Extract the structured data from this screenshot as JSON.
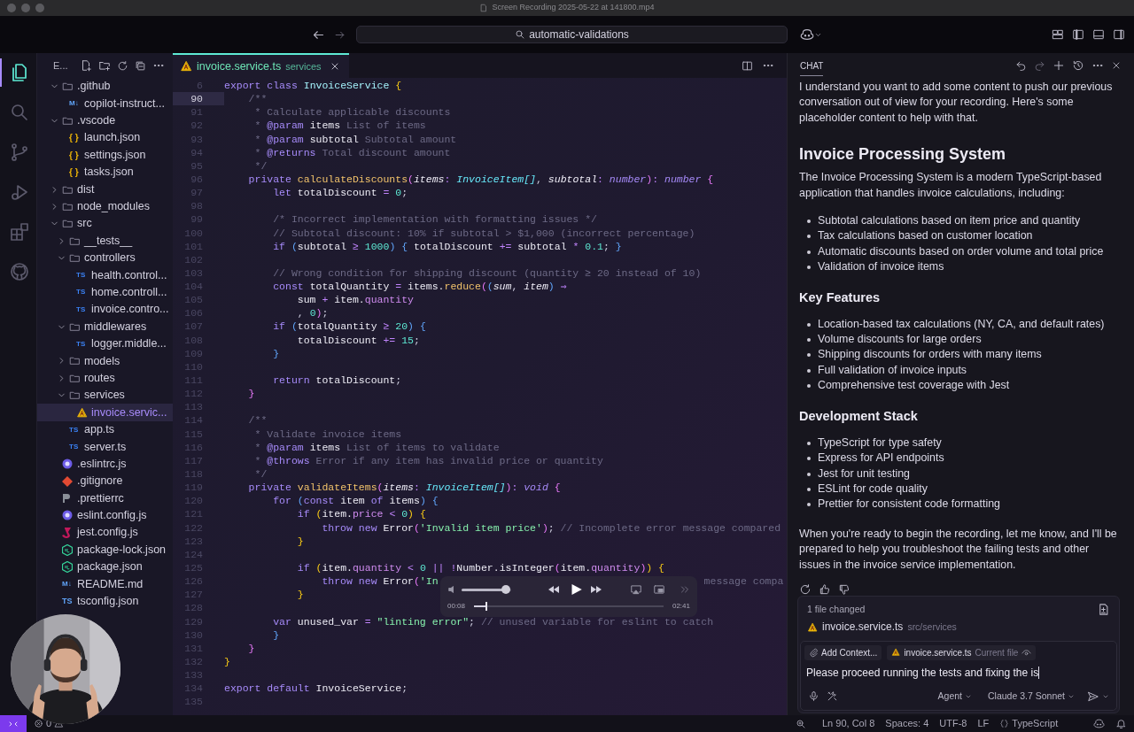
{
  "window": {
    "title": "Screen Recording 2025-05-22 at 141800.mp4"
  },
  "titlebar": {
    "search": "automatic-validations"
  },
  "activity_bar": [
    {
      "kind": "files",
      "selected": true
    },
    {
      "kind": "search",
      "selected": false
    },
    {
      "kind": "source-control",
      "selected": false
    },
    {
      "kind": "run",
      "selected": false
    },
    {
      "kind": "extensions",
      "selected": false
    },
    {
      "kind": "github",
      "selected": false
    }
  ],
  "explorer": {
    "title": "E...",
    "tree": [
      {
        "name": ".github",
        "kind": "folder",
        "expanded": true,
        "selected": false,
        "children": [
          {
            "name": "copilot-instruct...",
            "kind": "markdown",
            "badge": "M↓",
            "selected": false
          }
        ]
      },
      {
        "name": ".vscode",
        "kind": "folder",
        "expanded": true,
        "selected": false,
        "children": [
          {
            "name": "launch.json",
            "kind": "json",
            "badge": "{ }",
            "selected": false
          },
          {
            "name": "settings.json",
            "kind": "json",
            "badge": "{ }",
            "selected": false
          },
          {
            "name": "tasks.json",
            "kind": "json",
            "badge": "{ }",
            "selected": false
          }
        ]
      },
      {
        "name": "dist",
        "kind": "folder",
        "expanded": false,
        "selected": false
      },
      {
        "name": "node_modules",
        "kind": "folder",
        "expanded": false,
        "selected": false
      },
      {
        "name": "src",
        "kind": "folder",
        "expanded": true,
        "selected": false,
        "children": [
          {
            "name": "__tests__",
            "kind": "folder",
            "expanded": false,
            "selected": false
          },
          {
            "name": "controllers",
            "kind": "folder",
            "expanded": true,
            "selected": false,
            "children": [
              {
                "name": "health.control...",
                "kind": "ts",
                "badge": "TS",
                "selected": false
              },
              {
                "name": "home.controll...",
                "kind": "ts",
                "badge": "TS",
                "selected": false
              },
              {
                "name": "invoice.contro...",
                "kind": "ts",
                "badge": "TS",
                "selected": false
              }
            ]
          },
          {
            "name": "middlewares",
            "kind": "folder",
            "expanded": true,
            "selected": false,
            "children": [
              {
                "name": "logger.middle...",
                "kind": "ts",
                "badge": "TS",
                "selected": false
              }
            ]
          },
          {
            "name": "models",
            "kind": "folder",
            "expanded": false,
            "selected": false
          },
          {
            "name": "routes",
            "kind": "folder",
            "expanded": false,
            "selected": false
          },
          {
            "name": "services",
            "kind": "folder",
            "expanded": true,
            "selected": false,
            "children": [
              {
                "name": "invoice.servic...",
                "kind": "service",
                "selected": true
              }
            ]
          },
          {
            "name": "app.ts",
            "kind": "ts",
            "badge": "TS",
            "selected": false
          },
          {
            "name": "server.ts",
            "kind": "ts",
            "badge": "TS",
            "selected": false
          }
        ]
      },
      {
        "name": ".eslintrc.js",
        "kind": "eslint",
        "selected": false
      },
      {
        "name": ".gitignore",
        "kind": "git",
        "selected": false
      },
      {
        "name": ".prettierrc",
        "kind": "prettier",
        "selected": false
      },
      {
        "name": "eslint.config.js",
        "kind": "eslint",
        "selected": false
      },
      {
        "name": "jest.config.js",
        "kind": "jest",
        "selected": false
      },
      {
        "name": "package-lock.json",
        "kind": "node",
        "selected": false
      },
      {
        "name": "package.json",
        "kind": "node",
        "selected": false
      },
      {
        "name": "README.md",
        "kind": "markdown",
        "badge": "M↓",
        "selected": false
      },
      {
        "name": "tsconfig.json",
        "kind": "tsconfig",
        "badge": "TS",
        "selected": false
      }
    ]
  },
  "editor": {
    "tab": {
      "name": "invoice.service.ts",
      "folder": "services",
      "selected": true
    },
    "lines": [
      {
        "n": "6",
        "current": false,
        "t": [
          {
            "text": "export ",
            "kind": "k"
          },
          {
            "text": "class ",
            "kind": "k"
          },
          {
            "text": "InvoiceService ",
            "kind": "cls"
          },
          {
            "text": "{",
            "kind": "b1"
          }
        ]
      },
      {
        "n": "90",
        "current": true,
        "t": [
          {
            "text": "    /**",
            "kind": "c"
          }
        ]
      },
      {
        "n": "91",
        "current": false,
        "t": [
          {
            "text": "     * Calculate applicable discounts",
            "kind": "c"
          }
        ]
      },
      {
        "n": "92",
        "current": false,
        "t": [
          {
            "text": "     * ",
            "kind": "c"
          },
          {
            "text": "@param ",
            "kind": "d"
          },
          {
            "text": "items ",
            "kind": "id"
          },
          {
            "text": "List of items",
            "kind": "c"
          }
        ]
      },
      {
        "n": "93",
        "current": false,
        "t": [
          {
            "text": "     * ",
            "kind": "c"
          },
          {
            "text": "@param ",
            "kind": "d"
          },
          {
            "text": "subtotal ",
            "kind": "id"
          },
          {
            "text": "Subtotal amount",
            "kind": "c"
          }
        ]
      },
      {
        "n": "94",
        "current": false,
        "t": [
          {
            "text": "     * ",
            "kind": "c"
          },
          {
            "text": "@returns ",
            "kind": "d"
          },
          {
            "text": "Total discount amount",
            "kind": "c"
          }
        ]
      },
      {
        "n": "95",
        "current": false,
        "t": [
          {
            "text": "     */",
            "kind": "c"
          }
        ]
      },
      {
        "n": "96",
        "current": false,
        "t": [
          {
            "text": "    private ",
            "kind": "k"
          },
          {
            "text": "calculateDiscounts",
            "kind": "fn"
          },
          {
            "text": "(",
            "kind": "b2"
          },
          {
            "text": "items",
            "kind": "p"
          },
          {
            "text": ": ",
            "kind": "op"
          },
          {
            "text": "InvoiceItem[]",
            "kind": "t"
          },
          {
            "text": ", ",
            "kind": "pl"
          },
          {
            "text": "subtotal",
            "kind": "p"
          },
          {
            "text": ": ",
            "kind": "op"
          },
          {
            "text": "number",
            "kind": "ti"
          },
          {
            "text": ")",
            "kind": "b2"
          },
          {
            "text": ": ",
            "kind": "op"
          },
          {
            "text": "number ",
            "kind": "ti"
          },
          {
            "text": "{",
            "kind": "b2"
          }
        ]
      },
      {
        "n": "97",
        "current": false,
        "t": [
          {
            "text": "        let ",
            "kind": "k"
          },
          {
            "text": "totalDiscount ",
            "kind": "id"
          },
          {
            "text": "= ",
            "kind": "op"
          },
          {
            "text": "0",
            "kind": "n"
          },
          {
            "text": ";",
            "kind": "pl"
          }
        ]
      },
      {
        "n": "98",
        "current": false
      },
      {
        "n": "99",
        "current": false,
        "t": [
          {
            "text": "        /* Incorrect implementation with formatting issues */",
            "kind": "c"
          }
        ]
      },
      {
        "n": "100",
        "current": false,
        "t": [
          {
            "text": "        // Subtotal discount: 10% if subtotal > $1,000 (incorrect percentage)",
            "kind": "c"
          }
        ]
      },
      {
        "n": "101",
        "current": false,
        "t": [
          {
            "text": "        if ",
            "kind": "k"
          },
          {
            "text": "(",
            "kind": "b3"
          },
          {
            "text": "subtotal ",
            "kind": "id"
          },
          {
            "text": "≥ ",
            "kind": "op"
          },
          {
            "text": "1000",
            "kind": "n"
          },
          {
            "text": ") ",
            "kind": "b3"
          },
          {
            "text": "{ ",
            "kind": "b3"
          },
          {
            "text": "totalDiscount ",
            "kind": "id"
          },
          {
            "text": "+= ",
            "kind": "op"
          },
          {
            "text": "subtotal ",
            "kind": "id"
          },
          {
            "text": "* ",
            "kind": "op"
          },
          {
            "text": "0.1",
            "kind": "n"
          },
          {
            "text": "; ",
            "kind": "pl"
          },
          {
            "text": "}",
            "kind": "b3"
          }
        ]
      },
      {
        "n": "102",
        "current": false
      },
      {
        "n": "103",
        "current": false,
        "t": [
          {
            "text": "        // Wrong condition for shipping discount (quantity ≥ 20 instead of 10)",
            "kind": "c"
          }
        ]
      },
      {
        "n": "104",
        "current": false,
        "t": [
          {
            "text": "        const ",
            "kind": "k"
          },
          {
            "text": "totalQuantity ",
            "kind": "id"
          },
          {
            "text": "= ",
            "kind": "op"
          },
          {
            "text": "items.",
            "kind": "id"
          },
          {
            "text": "reduce",
            "kind": "fn"
          },
          {
            "text": "(",
            "kind": "b2"
          },
          {
            "text": "(",
            "kind": "b3"
          },
          {
            "text": "sum",
            "kind": "p"
          },
          {
            "text": ", ",
            "kind": "pl"
          },
          {
            "text": "item",
            "kind": "p"
          },
          {
            "text": ") ",
            "kind": "b3"
          },
          {
            "text": "⇒",
            "kind": "op"
          }
        ]
      },
      {
        "n": "105",
        "current": false,
        "t": [
          {
            "text": "            sum ",
            "kind": "id"
          },
          {
            "text": "+ ",
            "kind": "op"
          },
          {
            "text": "item.",
            "kind": "id"
          },
          {
            "text": "quantity",
            "kind": "prop"
          }
        ]
      },
      {
        "n": "106",
        "current": false,
        "t": [
          {
            "text": "            , ",
            "kind": "pl"
          },
          {
            "text": "0",
            "kind": "n"
          },
          {
            "text": ")",
            "kind": "b2"
          },
          {
            "text": ";",
            "kind": "pl"
          }
        ]
      },
      {
        "n": "107",
        "current": false,
        "t": [
          {
            "text": "        if ",
            "kind": "k"
          },
          {
            "text": "(",
            "kind": "b3"
          },
          {
            "text": "totalQuantity ",
            "kind": "id"
          },
          {
            "text": "≥ ",
            "kind": "op"
          },
          {
            "text": "20",
            "kind": "n"
          },
          {
            "text": ") ",
            "kind": "b3"
          },
          {
            "text": "{",
            "kind": "b3"
          }
        ]
      },
      {
        "n": "108",
        "current": false,
        "t": [
          {
            "text": "            totalDiscount ",
            "kind": "id"
          },
          {
            "text": "+= ",
            "kind": "op"
          },
          {
            "text": "15",
            "kind": "n"
          },
          {
            "text": ";",
            "kind": "pl"
          }
        ]
      },
      {
        "n": "109",
        "current": false,
        "t": [
          {
            "text": "        }",
            "kind": "b3"
          }
        ]
      },
      {
        "n": "110",
        "current": false
      },
      {
        "n": "111",
        "current": false,
        "t": [
          {
            "text": "        return ",
            "kind": "k"
          },
          {
            "text": "totalDiscount",
            "kind": "id"
          },
          {
            "text": ";",
            "kind": "pl"
          }
        ]
      },
      {
        "n": "112",
        "current": false,
        "t": [
          {
            "text": "    }",
            "kind": "b2"
          }
        ]
      },
      {
        "n": "113",
        "current": false
      },
      {
        "n": "114",
        "current": false,
        "t": [
          {
            "text": "    /**",
            "kind": "c"
          }
        ]
      },
      {
        "n": "115",
        "current": false,
        "t": [
          {
            "text": "     * Validate invoice items",
            "kind": "c"
          }
        ]
      },
      {
        "n": "116",
        "current": false,
        "t": [
          {
            "text": "     * ",
            "kind": "c"
          },
          {
            "text": "@param ",
            "kind": "d"
          },
          {
            "text": "items ",
            "kind": "id"
          },
          {
            "text": "List of items to validate",
            "kind": "c"
          }
        ]
      },
      {
        "n": "117",
        "current": false,
        "t": [
          {
            "text": "     * ",
            "kind": "c"
          },
          {
            "text": "@throws ",
            "kind": "d"
          },
          {
            "text": "Error if any item has invalid price or quantity",
            "kind": "c"
          }
        ]
      },
      {
        "n": "118",
        "current": false,
        "t": [
          {
            "text": "     */",
            "kind": "c"
          }
        ]
      },
      {
        "n": "119",
        "current": false,
        "t": [
          {
            "text": "    private ",
            "kind": "k"
          },
          {
            "text": "validateItems",
            "kind": "fn"
          },
          {
            "text": "(",
            "kind": "b2"
          },
          {
            "text": "items",
            "kind": "p"
          },
          {
            "text": ": ",
            "kind": "op"
          },
          {
            "text": "InvoiceItem[]",
            "kind": "t"
          },
          {
            "text": ")",
            "kind": "b2"
          },
          {
            "text": ": ",
            "kind": "op"
          },
          {
            "text": "void ",
            "kind": "ti"
          },
          {
            "text": "{",
            "kind": "b2"
          }
        ]
      },
      {
        "n": "120",
        "current": false,
        "t": [
          {
            "text": "        for ",
            "kind": "k"
          },
          {
            "text": "(",
            "kind": "b3"
          },
          {
            "text": "const ",
            "kind": "k"
          },
          {
            "text": "item ",
            "kind": "id"
          },
          {
            "text": "of ",
            "kind": "k"
          },
          {
            "text": "items",
            "kind": "id"
          },
          {
            "text": ") ",
            "kind": "b3"
          },
          {
            "text": "{",
            "kind": "b3"
          }
        ]
      },
      {
        "n": "121",
        "current": false,
        "t": [
          {
            "text": "            if ",
            "kind": "k"
          },
          {
            "text": "(",
            "kind": "b1"
          },
          {
            "text": "item.",
            "kind": "id"
          },
          {
            "text": "price ",
            "kind": "prop"
          },
          {
            "text": "< ",
            "kind": "op"
          },
          {
            "text": "0",
            "kind": "n"
          },
          {
            "text": ") ",
            "kind": "b1"
          },
          {
            "text": "{",
            "kind": "b1"
          }
        ]
      },
      {
        "n": "122",
        "current": false,
        "t": [
          {
            "text": "                throw ",
            "kind": "k"
          },
          {
            "text": "new ",
            "kind": "k"
          },
          {
            "text": "Error",
            "kind": "id"
          },
          {
            "text": "(",
            "kind": "b2"
          },
          {
            "text": "'Invalid item price'",
            "kind": "s"
          },
          {
            "text": ")",
            "kind": "b2"
          },
          {
            "text": "; ",
            "kind": "pl"
          },
          {
            "text": "// Incomplete error message compared",
            "kind": "c"
          }
        ]
      },
      {
        "n": "123",
        "current": false,
        "t": [
          {
            "text": "            }",
            "kind": "b1"
          }
        ]
      },
      {
        "n": "124",
        "current": false
      },
      {
        "n": "125",
        "current": false,
        "t": [
          {
            "text": "            if ",
            "kind": "k"
          },
          {
            "text": "(",
            "kind": "b1"
          },
          {
            "text": "item.",
            "kind": "id"
          },
          {
            "text": "quantity ",
            "kind": "prop"
          },
          {
            "text": "< ",
            "kind": "op"
          },
          {
            "text": "0 ",
            "kind": "n"
          },
          {
            "text": "|| ",
            "kind": "op"
          },
          {
            "text": "!",
            "kind": "op"
          },
          {
            "text": "Number.isInteger",
            "kind": "id"
          },
          {
            "text": "(",
            "kind": "b2"
          },
          {
            "text": "item.",
            "kind": "id"
          },
          {
            "text": "quantity",
            "kind": "prop"
          },
          {
            "text": ")",
            "kind": "b2"
          },
          {
            "text": ") ",
            "kind": "b1"
          },
          {
            "text": "{",
            "kind": "b1"
          }
        ]
      },
      {
        "n": "126",
        "current": false,
        "t": [
          {
            "text": "                throw ",
            "kind": "k"
          },
          {
            "text": "new ",
            "kind": "k"
          },
          {
            "text": "Error",
            "kind": "id"
          },
          {
            "text": "(",
            "kind": "b2"
          },
          {
            "text": "'In",
            "kind": "s"
          }
        ],
        "tail": "message compa"
      },
      {
        "n": "127",
        "current": false,
        "t": [
          {
            "text": "            }",
            "kind": "b1"
          }
        ]
      },
      {
        "n": "128",
        "current": false
      },
      {
        "n": "129",
        "current": false,
        "t": [
          {
            "text": "        var ",
            "kind": "k"
          },
          {
            "text": "unused_var ",
            "kind": "id"
          },
          {
            "text": "= ",
            "kind": "op"
          },
          {
            "text": "\"linting error\"",
            "kind": "s"
          },
          {
            "text": "; ",
            "kind": "pl"
          },
          {
            "text": "// unused variable for eslint to catch",
            "kind": "c"
          }
        ]
      },
      {
        "n": "130",
        "current": false,
        "t": [
          {
            "text": "        }",
            "kind": "b3"
          }
        ]
      },
      {
        "n": "131",
        "current": false,
        "t": [
          {
            "text": "    }",
            "kind": "b2"
          }
        ]
      },
      {
        "n": "132",
        "current": false,
        "t": [
          {
            "text": "}",
            "kind": "b1"
          }
        ]
      },
      {
        "n": "133",
        "current": false
      },
      {
        "n": "134",
        "current": false,
        "t": [
          {
            "text": "export ",
            "kind": "k"
          },
          {
            "text": "default ",
            "kind": "k"
          },
          {
            "text": "InvoiceService",
            "kind": "id"
          },
          {
            "text": ";",
            "kind": "pl"
          }
        ]
      },
      {
        "n": "135",
        "current": false
      }
    ]
  },
  "player": {
    "volume": {
      "level": 0.9
    },
    "progress": {
      "level": 0.06
    },
    "elapsed": "00:08",
    "duration": "02:41"
  },
  "chat": {
    "tab": {
      "label": "CHAT",
      "selected": true
    },
    "blocks": [
      {
        "kind": "p",
        "text": "I understand you want to add some content to push our previous conversation out of view for your recording. Here's some placeholder content to help with that."
      },
      {
        "kind": "h1",
        "text": "Invoice Processing System"
      },
      {
        "kind": "p",
        "text": "The Invoice Processing System is a modern TypeScript-based application that handles invoice calculations, including:"
      },
      {
        "kind": "ul",
        "items": [
          "Subtotal calculations based on item price and quantity",
          "Tax calculations based on customer location",
          "Automatic discounts based on order volume and total price",
          "Validation of invoice items"
        ]
      },
      {
        "kind": "h2",
        "text": "Key Features"
      },
      {
        "kind": "ul",
        "items": [
          "Location-based tax calculations (NY, CA, and default rates)",
          "Volume discounts for large orders",
          "Shipping discounts for orders with many items",
          "Full validation of invoice inputs",
          "Comprehensive test coverage with Jest"
        ]
      },
      {
        "kind": "h2",
        "text": "Development Stack"
      },
      {
        "kind": "ul",
        "items": [
          "TypeScript for type safety",
          "Express for API endpoints",
          "Jest for unit testing",
          "ESLint for code quality",
          "Prettier for consistent code formatting"
        ]
      },
      {
        "kind": "p",
        "text": "When you're ready to begin the recording, let me know, and I'll be prepared to help you troubleshoot the failing tests and other issues in the invoice service implementation."
      }
    ],
    "changes": {
      "summary": "1 file changed",
      "files": [
        {
          "name": "invoice.service.ts",
          "path": "src/services"
        }
      ]
    },
    "input": {
      "chips": [
        {
          "kind": "add",
          "label": "Add Context..."
        },
        {
          "kind": "file",
          "label": "invoice.service.ts",
          "note": "Current file"
        }
      ],
      "value": "Please proceed running the tests and fixing the is",
      "mode": "Agent",
      "model": "Claude 3.7 Sonnet"
    }
  },
  "status_bar": {
    "errors": "0",
    "position": "Ln 90, Col 8",
    "indent": "Spaces: 4",
    "encoding": "UTF-8",
    "eol": "LF",
    "language": "TypeScript"
  }
}
